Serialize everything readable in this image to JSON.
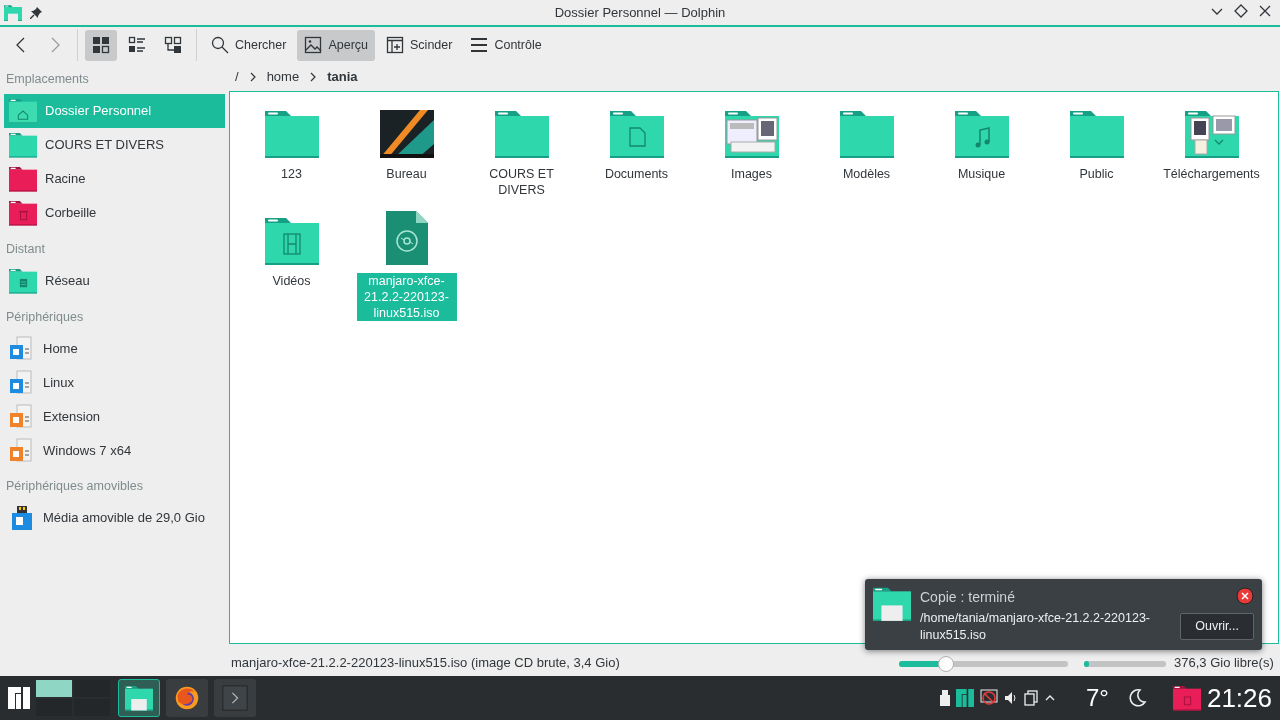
{
  "window": {
    "title": "Dossier Personnel — Dolphin"
  },
  "toolbar": [
    {
      "kind": "back"
    },
    {
      "kind": "forward"
    },
    {
      "kind": "view-icons",
      "selected": true
    },
    {
      "kind": "view-details",
      "selected": false
    },
    {
      "kind": "view-compact",
      "selected": false
    },
    {
      "kind": "search",
      "label": "Chercher",
      "selected": false
    },
    {
      "kind": "preview",
      "label": "Aperçu",
      "selected": true
    },
    {
      "kind": "split",
      "label": "Scinder",
      "selected": false
    },
    {
      "kind": "menu",
      "label": "Contrôle",
      "selected": false
    }
  ],
  "breadcrumb": [
    {
      "label": "/",
      "current": false
    },
    {
      "label": "home",
      "current": false
    },
    {
      "label": "tania",
      "current": true
    }
  ],
  "sidebar": [
    {
      "title": "Emplacements",
      "items": [
        {
          "label": "Dossier Personnel",
          "kind": "home",
          "selected": true
        },
        {
          "label": "COURS ET DIVERS",
          "kind": "folder",
          "selected": false
        },
        {
          "label": "Racine",
          "kind": "root",
          "selected": false
        },
        {
          "label": "Corbeille",
          "kind": "trash",
          "selected": false
        }
      ]
    },
    {
      "title": "Distant",
      "items": [
        {
          "label": "Réseau",
          "kind": "network",
          "selected": false
        }
      ]
    },
    {
      "title": "Périphériques",
      "items": [
        {
          "label": "Home",
          "kind": "drive-blue",
          "selected": false
        },
        {
          "label": "Linux",
          "kind": "drive-blue",
          "selected": false
        },
        {
          "label": "Extension",
          "kind": "drive-orange",
          "selected": false
        },
        {
          "label": "Windows 7 x64",
          "kind": "drive-orange",
          "selected": false
        }
      ]
    },
    {
      "title": "Périphériques amovibles",
      "items": [
        {
          "label": "Média amovible de 29,0 Gio",
          "kind": "usb",
          "selected": false
        }
      ]
    }
  ],
  "files": [
    {
      "label": "123",
      "kind": "folder",
      "selected": false
    },
    {
      "label": "Bureau",
      "kind": "desktop",
      "selected": false
    },
    {
      "label": "COURS ET DIVERS",
      "kind": "folder",
      "selected": false
    },
    {
      "label": "Documents",
      "kind": "documents",
      "selected": false
    },
    {
      "label": "Images",
      "kind": "images",
      "selected": false
    },
    {
      "label": "Modèles",
      "kind": "folder",
      "selected": false
    },
    {
      "label": "Musique",
      "kind": "music",
      "selected": false
    },
    {
      "label": "Public",
      "kind": "folder",
      "selected": false
    },
    {
      "label": "Téléchargements",
      "kind": "downloads",
      "selected": false
    },
    {
      "label": "Vidéos",
      "kind": "videos",
      "selected": false
    },
    {
      "label": "manjaro-xfce-21.2.2-220123-linux515.iso",
      "kind": "iso",
      "selected": true
    }
  ],
  "status_bar": {
    "text": "manjaro-xfce-21.2.2-220123-linux515.iso (image CD brute, 3,4 Gio)",
    "zoom": {
      "level": 0.28
    },
    "space": {
      "level": 0.06
    },
    "free": "376,3 Gio libre(s)"
  },
  "notification": {
    "title": "Copie : terminé",
    "body": "/home/tania/manjaro-xfce-21.2.2-220123-linux515.iso",
    "button": "Ouvrir..."
  },
  "taskbar": {
    "tasks": [
      {
        "kind": "files",
        "active": true
      },
      {
        "kind": "browser",
        "active": false
      },
      {
        "kind": "terminal",
        "active": false
      }
    ],
    "weather": "7°",
    "clock": "21:26"
  }
}
